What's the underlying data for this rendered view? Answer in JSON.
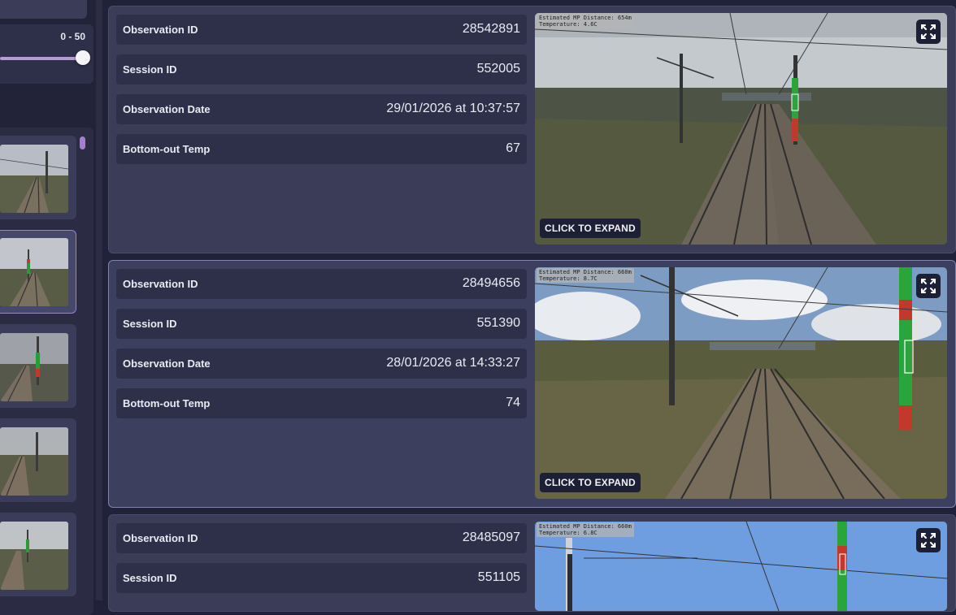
{
  "filter": {
    "range_label": "0 - 50",
    "slider_value": 50
  },
  "observations": [
    {
      "fields": [
        {
          "label": "Observation ID",
          "value": "28542891"
        },
        {
          "label": "Session ID",
          "value": "552005"
        },
        {
          "label": "Observation Date",
          "value": "29/01/2026 at 10:37:57"
        },
        {
          "label": "Bottom-out Temp",
          "value": "67"
        }
      ],
      "image_overlay": [
        "Estimated MP Distance: 654m",
        "Temperature: 4.6C"
      ],
      "expand_label": "CLICK TO EXPAND"
    },
    {
      "fields": [
        {
          "label": "Observation ID",
          "value": "28494656"
        },
        {
          "label": "Session ID",
          "value": "551390"
        },
        {
          "label": "Observation Date",
          "value": "28/01/2026 at 14:33:27"
        },
        {
          "label": "Bottom-out Temp",
          "value": "74"
        }
      ],
      "image_overlay": [
        "Estimated MP Distance: 660m",
        "Temperature: 8.7C"
      ],
      "expand_label": "CLICK TO EXPAND"
    },
    {
      "fields": [
        {
          "label": "Observation ID",
          "value": "28485097"
        },
        {
          "label": "Session ID",
          "value": "551105"
        }
      ],
      "image_overlay": [
        "Estimated MP Distance: 660m",
        "Temperature: 6.8C"
      ],
      "expand_label": ""
    }
  ],
  "icons": {
    "expand": "expand-arrows-icon"
  },
  "colors": {
    "accent": "#9a82d8",
    "background": "#21223a",
    "card": "#3a3c58",
    "field": "#2e3049"
  }
}
